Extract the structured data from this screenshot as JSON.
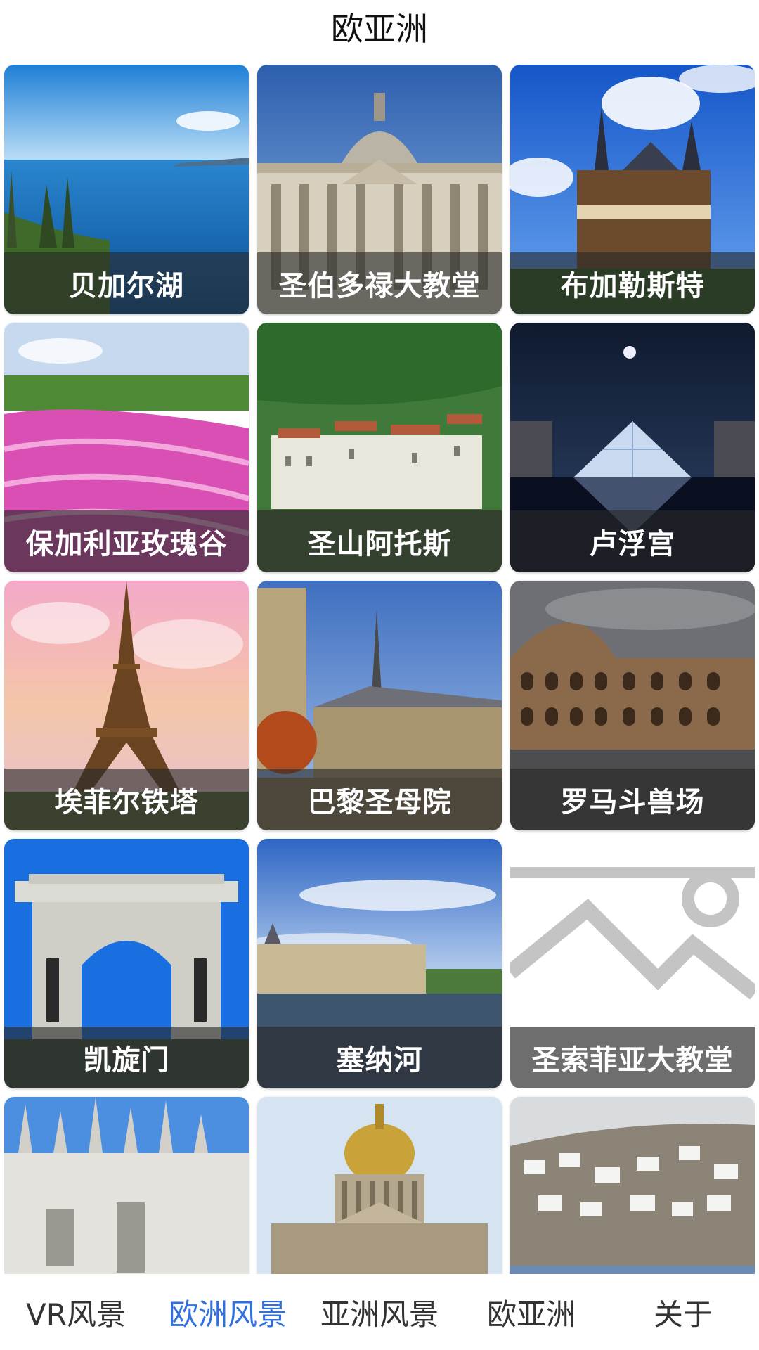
{
  "header": {
    "title": "欧亚洲"
  },
  "cards": [
    {
      "label": "贝加尔湖",
      "image": "lake-baikal"
    },
    {
      "label": "圣伯多禄大教堂",
      "image": "st-peters-basilica"
    },
    {
      "label": "布加勒斯特",
      "image": "castle-bucharest"
    },
    {
      "label": "保加利亚玫瑰谷",
      "image": "rose-valley"
    },
    {
      "label": "圣山阿托斯",
      "image": "mount-athos"
    },
    {
      "label": "卢浮宫",
      "image": "louvre-pyramid-night"
    },
    {
      "label": "埃菲尔铁塔",
      "image": "eiffel-tower"
    },
    {
      "label": "巴黎圣母院",
      "image": "notre-dame"
    },
    {
      "label": "罗马斗兽场",
      "image": "colosseum"
    },
    {
      "label": "凯旋门",
      "image": "triumphal-arch"
    },
    {
      "label": "塞纳河",
      "image": "seine-river"
    },
    {
      "label": "圣索菲亚大教堂",
      "image": "image-placeholder-icon"
    },
    {
      "label": "",
      "image": "milan-cathedral"
    },
    {
      "label": "",
      "image": "st-isaacs-cathedral"
    },
    {
      "label": "",
      "image": "white-hillside-town"
    }
  ],
  "bottom_nav": {
    "items": [
      {
        "label": "VR风景",
        "active": false
      },
      {
        "label": "欧洲风景",
        "active": true
      },
      {
        "label": "亚洲风景",
        "active": false
      },
      {
        "label": "欧亚洲",
        "active": false
      },
      {
        "label": "关于",
        "active": false
      }
    ],
    "active_color": "#2f6fe0"
  }
}
